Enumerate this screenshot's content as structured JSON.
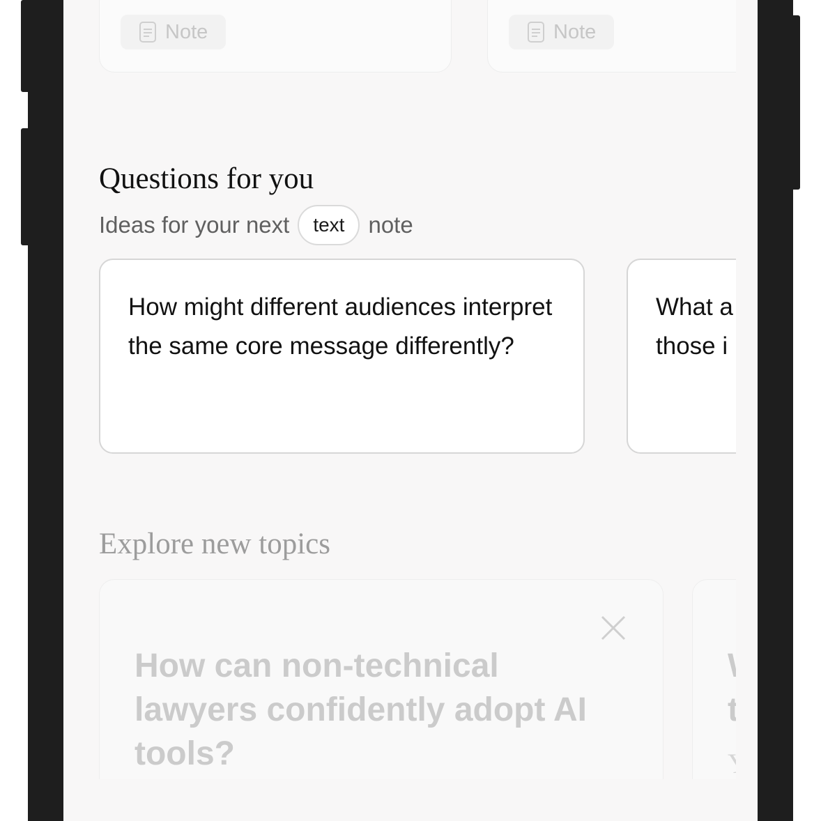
{
  "notes": [
    {
      "icon": "document-icon",
      "label": "Note"
    },
    {
      "icon": "document-icon",
      "label": "Note"
    }
  ],
  "questions": {
    "title": "Questions for you",
    "subtitle_prefix": "Ideas for your next",
    "subtitle_pill": "text",
    "subtitle_suffix": "note",
    "cards": [
      {
        "text": "How might different audiences interpret the same core message differently?"
      },
      {
        "text": "What a those i"
      }
    ]
  },
  "explore": {
    "title": "Explore new topics",
    "cards": [
      {
        "title": "How can non-technical lawyers confidently adopt AI tools?",
        "close_icon": "close-icon"
      },
      {
        "title": "W th",
        "subtitle": "Yo"
      }
    ]
  },
  "colors": {
    "bezel": "#1e1e1e",
    "screen_bg": "#f8f7f7",
    "card_border": "#d6d6d6",
    "faded_text": "#cbcbcb"
  }
}
